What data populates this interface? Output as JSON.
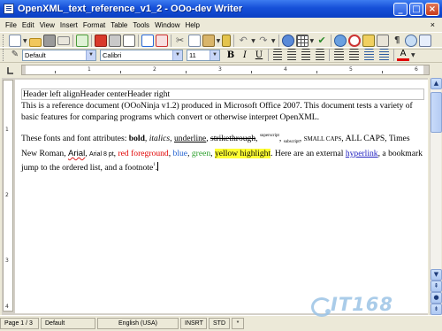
{
  "window": {
    "title": "OpenXML_text_reference_v1_2 - OOo-dev Writer"
  },
  "menu": {
    "items": [
      "File",
      "Edit",
      "View",
      "Insert",
      "Format",
      "Table",
      "Tools",
      "Window",
      "Help"
    ],
    "close_doc": "×"
  },
  "formatting": {
    "style": "Default",
    "font": "Calibri",
    "size": "11"
  },
  "icons": {
    "toolbar1": [
      "new-document-icon",
      "open-icon",
      "save-icon",
      "email-icon",
      "edit-file-icon",
      "export-pdf-icon",
      "print-icon",
      "page-preview-icon",
      "spellcheck-icon",
      "autospellcheck-icon",
      "cut-icon",
      "copy-icon",
      "paste-icon",
      "format-paintbrush-icon",
      "undo-icon",
      "redo-icon",
      "hyperlink-icon",
      "table-icon",
      "show-draw-functions-icon",
      "find-replace-icon",
      "navigator-icon",
      "gallery-icon",
      "data-sources-icon",
      "nonprinting-characters-icon",
      "zoom-icon",
      "help-icon"
    ],
    "toolbar2": [
      "styles-formatting-icon",
      "bold-icon",
      "italic-icon",
      "underline-icon",
      "align-left-icon",
      "align-center-icon",
      "align-right-icon",
      "justify-icon",
      "numbering-icon",
      "bullets-icon",
      "decrease-indent-icon",
      "increase-indent-icon",
      "font-color-icon"
    ]
  },
  "document": {
    "header_text": "Header left alignHeader centerHeader right",
    "para1": "This is a reference document (OOoNinja v1.2) produced in Microsoft Office 2007.  This document tests a variety of basic features for comparing programs which convert or otherwise interpret OpenXML.",
    "para2": {
      "lead": "These fonts and font attributes:  ",
      "bold": "bold",
      "italics": "italics",
      "underline": "underline",
      "strikethrough": "strikethrough",
      "superscript": "superscript",
      "subscript": "subscript",
      "small_caps": "SMALL CAPS",
      "all_caps": "ALL CAPS",
      "times": "Times New Roman",
      "arial": "Arial",
      "arial8": "Arial 8 pt",
      "red": "red foreground",
      "blue": "blue",
      "green": "green",
      "yellow": "yellow highlight",
      "link_lead": "Here are an external ",
      "hyperlink": "hyperlink",
      "tail": "a bookmark jump to the ordered list, and a footnote"
    },
    "cursor_mark": "1"
  },
  "ruler": {
    "h_numbers": [
      "1",
      "2",
      "3",
      "4",
      "5",
      "6"
    ],
    "v_numbers": [
      "1",
      "2",
      "3",
      "4"
    ]
  },
  "status": {
    "page": "Page 1 / 3",
    "style": "Default",
    "language": "English (USA)",
    "insert_mode": "INSRT",
    "selection_mode": "STD",
    "modified": "*"
  },
  "watermark": {
    "text": "IT168.com"
  },
  "colors": {
    "titlebar": "#1650d8",
    "red_text": "#e00000",
    "blue_text": "#1f5fd0",
    "green_text": "#2ca02c",
    "highlight": "#ffff33",
    "link": "#2020c0"
  }
}
